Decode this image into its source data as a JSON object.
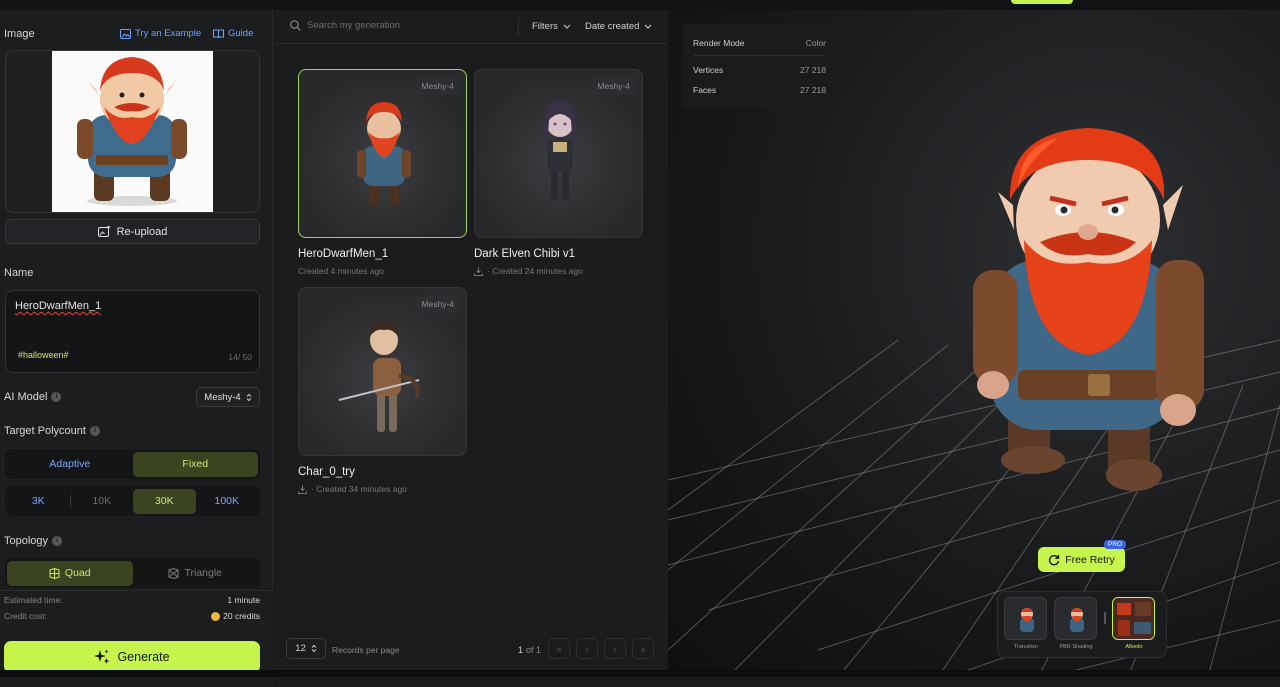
{
  "left": {
    "image_label": "Image",
    "try_example": "Try an Example",
    "guide": "Guide",
    "reupload": "Re-upload",
    "name_label": "Name",
    "name_value": "HeroDwarfMen_1",
    "tag": "#halloween#",
    "char_count": "14/ 50",
    "ai_model_label": "AI Model",
    "ai_model_value": "Meshy-4",
    "polycount_label": "Target Polycount",
    "poly_modes": [
      "Adaptive",
      "Fixed"
    ],
    "poly_values": [
      "3K",
      "10K",
      "30K",
      "100K"
    ],
    "topology_label": "Topology",
    "topology_options": [
      "Quad",
      "Triangle"
    ],
    "est_time_label": "Estimated time:",
    "est_time_value": "1 minute",
    "credit_label": "Credit cost:",
    "credit_value": "20 credits",
    "generate": "Generate"
  },
  "mid": {
    "search_placeholder": "Search my generation",
    "filters": "Filters",
    "sort": "Date created",
    "cards": [
      {
        "badge": "Meshy-4",
        "title": "HeroDwarfMen_1",
        "sub": "Created 4 minutes ago"
      },
      {
        "badge": "Meshy-4",
        "title": "Dark Elven Chibi v1",
        "sub": "· Created 24 minutes ago"
      },
      {
        "badge": "Meshy-4",
        "title": "Char_0_try",
        "sub": "· Created 34 minutes ago"
      }
    ],
    "per_page": "12",
    "per_page_label": "Records per page",
    "page_current": "1",
    "page_of": "of 1"
  },
  "viewer": {
    "render_mode_label": "Render Mode",
    "render_mode_value": "Color",
    "vertices_label": "Vertices",
    "vertices_value": "27 218",
    "faces_label": "Faces",
    "faces_value": "27 218",
    "retry": "Free Retry",
    "pro": "PRO",
    "textures": [
      "Transition",
      "PBR Shading",
      "Albedo"
    ]
  },
  "colors": {
    "accent": "#c6f54e",
    "link": "#6aa3ff",
    "bg": "#1a1b1d"
  }
}
